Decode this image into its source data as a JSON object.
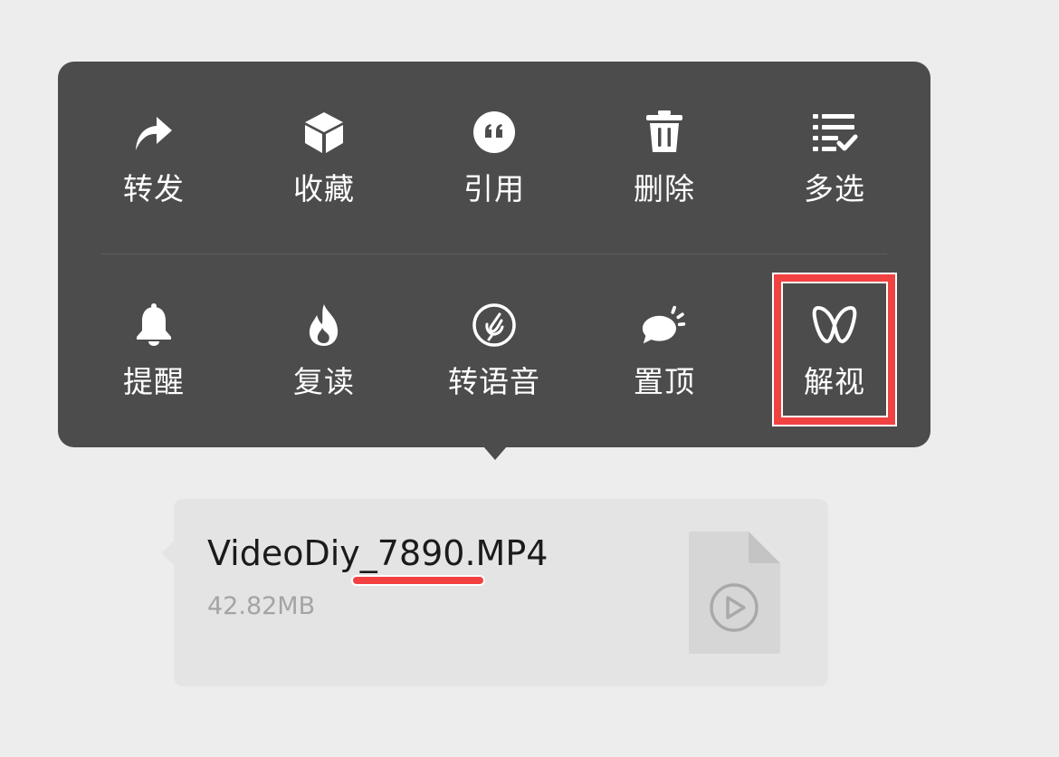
{
  "context_menu": {
    "row1": [
      {
        "label": "转发",
        "icon": "forward-icon"
      },
      {
        "label": "收藏",
        "icon": "favorite-box-icon"
      },
      {
        "label": "引用",
        "icon": "quote-icon"
      },
      {
        "label": "删除",
        "icon": "trash-icon"
      },
      {
        "label": "多选",
        "icon": "multi-select-icon"
      }
    ],
    "row2": [
      {
        "label": "提醒",
        "icon": "bell-icon"
      },
      {
        "label": "复读",
        "icon": "flame-icon"
      },
      {
        "label": "转语音",
        "icon": "speech-icon"
      },
      {
        "label": "置顶",
        "icon": "pin-bubble-icon"
      },
      {
        "label": "解视",
        "icon": "infinity-icon"
      }
    ]
  },
  "message": {
    "file_name": "VideoDiy_7890.MP4",
    "file_size": "42.82MB",
    "file_icon": "video-file-icon"
  },
  "colors": {
    "menu_background": "#4c4c4c",
    "page_background": "#ededed",
    "bubble_background": "#e4e4e4",
    "highlight": "#f24141"
  }
}
